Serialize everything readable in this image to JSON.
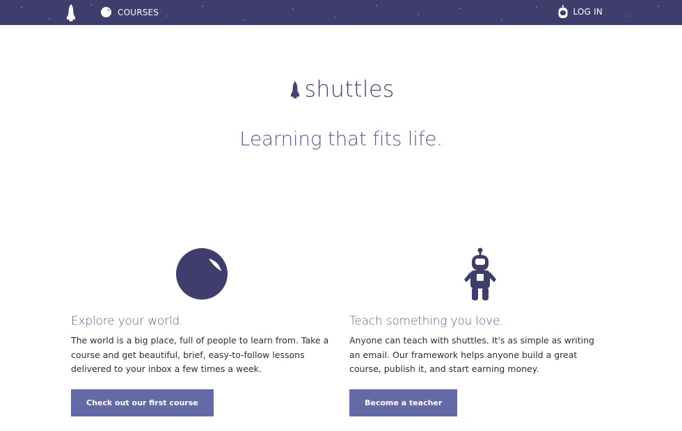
{
  "nav": {
    "home_icon": "rocket-icon",
    "courses_icon": "planet-icon",
    "courses_label": "COURSES",
    "login_icon": "astronaut-helmet-icon",
    "login_label": "LOG IN"
  },
  "brand": {
    "logo_icon": "rocket-icon",
    "name": "shuttles"
  },
  "hero": {
    "tagline": "Learning that fits life."
  },
  "features": [
    {
      "icon": "planet-icon",
      "title": "Explore your world.",
      "text": "The world is a big place, full of people to learn from. Take a course and get beautiful, brief, easy-to-follow lessons delivered to your inbox a few times a week.",
      "button_label": "Check out our first course"
    },
    {
      "icon": "astronaut-icon",
      "title": "Teach something you love.",
      "text": "Anyone can teach with shuttles. It's as simple as writing an email. Our framework helps anyone build a great course, publish it, and start earning money.",
      "button_label": "Become a teacher"
    }
  ],
  "colors": {
    "topbar": "#3f3d6b",
    "brand": "#454470",
    "accent": "#585a93",
    "button": "#646aa6"
  }
}
